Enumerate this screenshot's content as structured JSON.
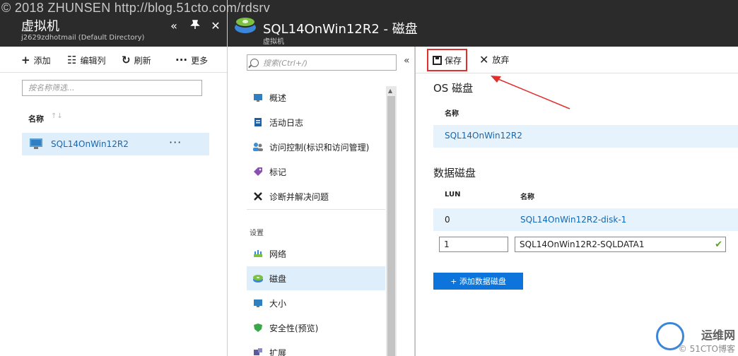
{
  "watermark_top": "© 2018 ZHUNSEN http://blog.51cto.com/rdsrv",
  "blade1": {
    "title": "虚拟机",
    "subtitle": "j2629zdhotmail (Default Directory)",
    "header_controls": [
      "«",
      "📌",
      "✕"
    ],
    "commands": [
      {
        "icon": "+",
        "label": "添加"
      },
      {
        "icon": "☷",
        "label": "编辑列"
      },
      {
        "icon": "↻",
        "label": "刷新"
      },
      {
        "icon": "···",
        "label": "更多"
      }
    ],
    "filter_placeholder": "按名称筛选...",
    "column_name": "名称",
    "sort_glyph": "↑↓",
    "vm_row": {
      "name": "SQL14OnWin12R2",
      "more": "···"
    }
  },
  "blade2": {
    "title": "SQL14OnWin12R2 - 磁盘",
    "subtitle": "虚拟机",
    "search_placeholder": "搜索(Ctrl+/)",
    "collapse": "«",
    "menu_items": [
      {
        "label": "概述",
        "icon": "overview-icon"
      },
      {
        "label": "活动日志",
        "icon": "activity-log-icon"
      },
      {
        "label": "访问控制(标识和访问管理)",
        "icon": "access-control-icon"
      },
      {
        "label": "标记",
        "icon": "tag-icon"
      },
      {
        "label": "诊断并解决问题",
        "icon": "wrench-icon"
      }
    ],
    "settings_section": "设置",
    "settings_items": [
      {
        "label": "网络",
        "icon": "network-icon"
      },
      {
        "label": "磁盘",
        "icon": "disk-icon",
        "selected": true
      },
      {
        "label": "大小",
        "icon": "size-icon"
      },
      {
        "label": "安全性(预览)",
        "icon": "shield-icon"
      },
      {
        "label": "扩展",
        "icon": "extensions-icon"
      }
    ]
  },
  "content": {
    "save_label": "保存",
    "discard_label": "放弃",
    "os_disk_title": "OS 磁盘",
    "os_disk_col": "名称",
    "os_disk_name": "SQL14OnWin12R2",
    "data_disks_title": "数据磁盘",
    "col_lun": "LUN",
    "col_name": "名称",
    "rows": [
      {
        "lun": "0",
        "name": "SQL14OnWin12R2-disk-1"
      }
    ],
    "new_row": {
      "lun": "1",
      "name": "SQL14OnWin12R2-SQLDATA1"
    },
    "add_button": "+ 添加数据磁盘",
    "accent_color": "#0c74da",
    "highlight_color": "#e0302b"
  },
  "watermark_br": {
    "line1": "运维网",
    "line2": "© 51CTO博客"
  }
}
